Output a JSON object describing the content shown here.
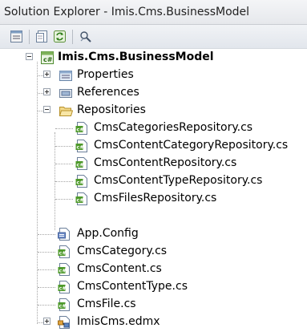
{
  "window": {
    "title": "Solution Explorer - Imis.Cms.BusinessModel"
  },
  "toolbar": {
    "buttons": [
      "properties-icon",
      "show-all-files-icon",
      "refresh-icon",
      "class-diagram-icon"
    ]
  },
  "tree": {
    "project": {
      "label": "Imis.Cms.BusinessModel",
      "icon": "csharp-project-icon",
      "expanded": true
    },
    "properties": {
      "label": "Properties",
      "icon": "properties-folder-icon",
      "expanded": false
    },
    "references": {
      "label": "References",
      "icon": "references-icon",
      "expanded": false
    },
    "repositories": {
      "label": "Repositories",
      "icon": "folder-open-icon",
      "expanded": true,
      "files": [
        "CmsCategoriesRepository.cs",
        "CmsContentCategoryRepository.cs",
        "CmsContentRepository.cs",
        "CmsContentTypeRepository.cs",
        "CmsFilesRepository.cs"
      ]
    },
    "items": [
      {
        "label": "App.Config",
        "icon": "config-file-icon"
      },
      {
        "label": "CmsCategory.cs",
        "icon": "csharp-file-icon"
      },
      {
        "label": "CmsContent.cs",
        "icon": "csharp-file-icon"
      },
      {
        "label": "CmsContentType.cs",
        "icon": "csharp-file-icon"
      },
      {
        "label": "CmsFile.cs",
        "icon": "csharp-file-icon"
      },
      {
        "label": "ImisCms.edmx",
        "icon": "edmx-file-icon",
        "expandable": true,
        "expanded": false
      }
    ]
  }
}
